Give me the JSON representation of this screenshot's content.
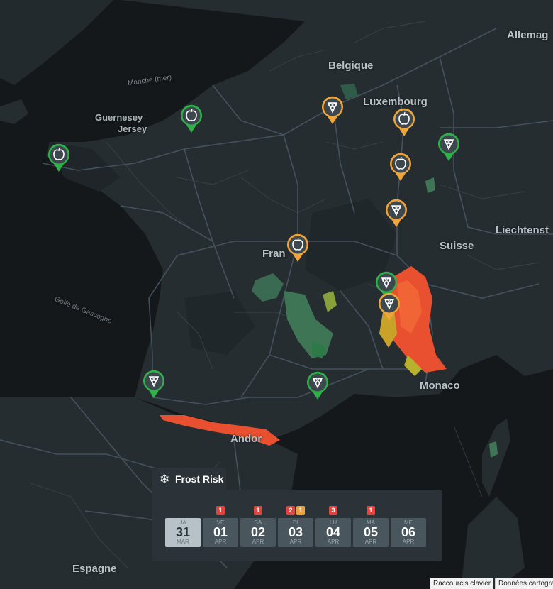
{
  "map": {
    "labels": {
      "belgique": "Belgique",
      "luxembourg": "Luxembourg",
      "allemagne": "Allemag",
      "manche": "Manche (mer)",
      "guernesey": "Guernesey",
      "jersey": "Jersey",
      "liechtenstein": "Liechtenst",
      "suisse": "Suisse",
      "france": "Fran",
      "golfe": "Golfe de Gascogne",
      "monaco": "Monaco",
      "andorre": "Andor",
      "espagne": "Espagne"
    },
    "markers": [
      {
        "crop": "apple-icon",
        "status": "green"
      },
      {
        "crop": "apple-icon",
        "status": "green"
      },
      {
        "crop": "grape-icon",
        "status": "orange"
      },
      {
        "crop": "apple-icon",
        "status": "orange"
      },
      {
        "crop": "grape-icon",
        "status": "green"
      },
      {
        "crop": "apple-icon",
        "status": "orange"
      },
      {
        "crop": "grape-icon",
        "status": "orange"
      },
      {
        "crop": "apple-icon",
        "status": "orange"
      },
      {
        "crop": "grape-icon",
        "status": "green"
      },
      {
        "crop": "grape-icon",
        "status": "orange"
      },
      {
        "crop": "grape-icon",
        "status": "green"
      },
      {
        "crop": "grape-icon",
        "status": "green"
      }
    ]
  },
  "frost_risk": {
    "title": "Frost Risk",
    "icon": "snowflake-icon",
    "days": [
      {
        "dow": "JA",
        "day": "31",
        "month": "MAR",
        "selected": true,
        "badges": []
      },
      {
        "dow": "VE",
        "day": "01",
        "month": "APR",
        "selected": false,
        "badges": [
          {
            "count": "1",
            "level": "red"
          }
        ]
      },
      {
        "dow": "SA",
        "day": "02",
        "month": "APR",
        "selected": false,
        "badges": [
          {
            "count": "1",
            "level": "red"
          }
        ]
      },
      {
        "dow": "DI",
        "day": "03",
        "month": "APR",
        "selected": false,
        "badges": [
          {
            "count": "2",
            "level": "red"
          },
          {
            "count": "1",
            "level": "orange"
          }
        ]
      },
      {
        "dow": "LU",
        "day": "04",
        "month": "APR",
        "selected": false,
        "badges": [
          {
            "count": "3",
            "level": "red"
          }
        ]
      },
      {
        "dow": "MA",
        "day": "05",
        "month": "APR",
        "selected": false,
        "badges": [
          {
            "count": "1",
            "level": "red"
          }
        ]
      },
      {
        "dow": "ME",
        "day": "06",
        "month": "APR",
        "selected": false,
        "badges": []
      }
    ]
  },
  "footer": {
    "shortcuts": "Raccourcis clavier",
    "map_data": "Données cartogra"
  },
  "colors": {
    "green": "#2fb14a",
    "orange": "#f0a53a",
    "frost_red": "#e8502f",
    "land": "#262d31",
    "sea": "#15191c",
    "roads": "#4b5a66"
  }
}
